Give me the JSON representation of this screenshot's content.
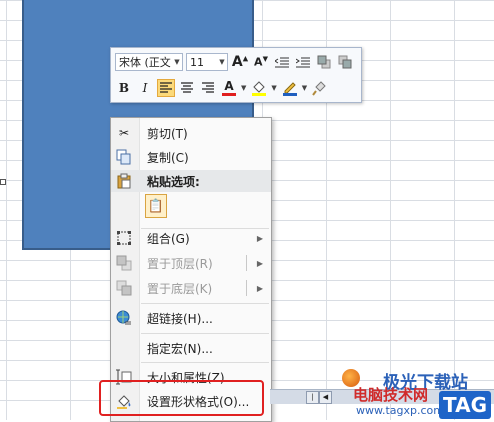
{
  "toolbar": {
    "font_name": "宋体 (正文",
    "font_size": "11",
    "bold": "B",
    "italic": "I",
    "font_color_label": "A"
  },
  "menu": {
    "cut": "剪切(T)",
    "copy": "复制(C)",
    "paste_options": "粘贴选项:",
    "group": "组合(G)",
    "bring_front": "置于顶层(R)",
    "send_back": "置于底层(K)",
    "hyperlink": "超链接(H)...",
    "assign_macro": "指定宏(N)...",
    "size_properties": "大小和属性(Z)...",
    "format_shape": "设置形状格式(O)..."
  },
  "watermark": {
    "line1": "极光下载站",
    "line2": "电脑技术网",
    "url": "www.tagxp.com",
    "tag": "TAG"
  },
  "colors": {
    "shape_fill": "#4f81bd",
    "highlight_box": "#e02020",
    "font_color_bar": "#e01f1f",
    "fill_color_bar": "#ffff00"
  }
}
